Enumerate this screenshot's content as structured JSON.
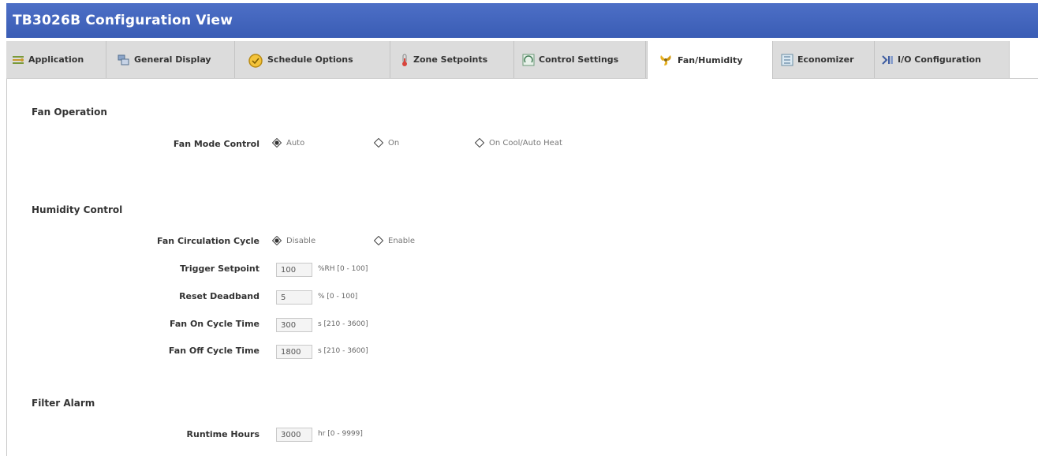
{
  "window": {
    "title": "TB3026B Configuration View"
  },
  "tabs": [
    {
      "label": "Application",
      "icon": "application-icon"
    },
    {
      "label": "General Display",
      "icon": "display-icon"
    },
    {
      "label": "Schedule Options",
      "icon": "clock-icon"
    },
    {
      "label": "Zone Setpoints",
      "icon": "thermometer-icon"
    },
    {
      "label": "Control Settings",
      "icon": "control-icon"
    },
    {
      "label": "Fan/Humidity",
      "icon": "fan-icon",
      "active": true
    },
    {
      "label": "Economizer",
      "icon": "economizer-icon"
    },
    {
      "label": "I/O Configuration",
      "icon": "io-icon"
    }
  ],
  "fan_operation": {
    "heading": "Fan Operation",
    "mode_label": "Fan Mode Control",
    "options": [
      "Auto",
      "On",
      "On Cool/Auto Heat"
    ],
    "selected": "Auto"
  },
  "humidity_control": {
    "heading": "Humidity Control",
    "cycle_label": "Fan Circulation Cycle",
    "cycle_options": [
      "Disable",
      "Enable"
    ],
    "cycle_selected": "Disable",
    "fields": [
      {
        "label": "Trigger Setpoint",
        "value": "100",
        "unit": "%RH [0 - 100]"
      },
      {
        "label": "Reset Deadband",
        "value": "5",
        "unit": "% [0 - 100]"
      },
      {
        "label": "Fan On Cycle Time",
        "value": "300",
        "unit": "s [210 - 3600]"
      },
      {
        "label": "Fan Off Cycle Time",
        "value": "1800",
        "unit": "s [210 - 3600]"
      }
    ]
  },
  "filter_alarm": {
    "heading": "Filter Alarm",
    "runtime_label": "Runtime Hours",
    "runtime_value": "3000",
    "runtime_unit": "hr [0 - 9999]"
  },
  "colors": {
    "titlebar": "#3f62ba",
    "tabstrip": "#dcdcdc",
    "selected_radio": "#333333"
  }
}
